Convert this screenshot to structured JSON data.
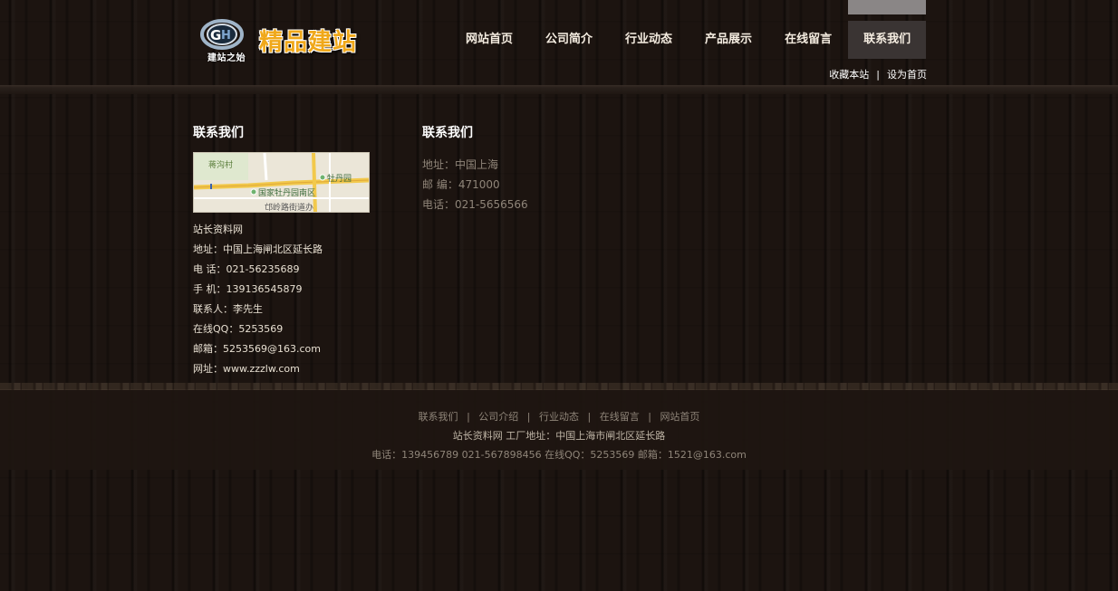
{
  "logo": {
    "small_text": "建站之始",
    "main_text": "精品建站"
  },
  "nav": {
    "items": [
      {
        "label": "网站首页"
      },
      {
        "label": "公司简介"
      },
      {
        "label": "行业动态"
      },
      {
        "label": "产品展示"
      },
      {
        "label": "在线留言"
      },
      {
        "label": "联系我们"
      }
    ],
    "active_index": 5
  },
  "top_links": {
    "bookmark": "收藏本站",
    "separator": "|",
    "set_home": "设为首页"
  },
  "sidebar": {
    "title": "联系我们",
    "map": {
      "labels": [
        "蒋沟村",
        "牡丹园",
        "国家牡丹园南区",
        "邙岭路街道办"
      ]
    },
    "rows": [
      "站长资料网",
      "地址：中国上海闸北区延长路",
      "电 话：021-56235689",
      "手 机：139136545879",
      "联系人：李先生",
      "在线QQ：5253569",
      "邮箱：5253569@163.com",
      "网址：www.zzzlw.com"
    ]
  },
  "content": {
    "title": "联系我们",
    "rows": [
      "地址：中国上海",
      "邮 编：471000",
      "电话：021-5656566"
    ]
  },
  "footer": {
    "links": [
      "联系我们",
      "公司介绍",
      "行业动态",
      "在线留言",
      "网站首页"
    ],
    "separator": "|",
    "address": "站长资料网 工厂地址：中国上海市闸北区延长路",
    "contact": "电话：139456789 021-567898456 在线QQ：5253569 邮箱：1521@163.com"
  },
  "colors": {
    "accent": "#f0a81a",
    "nav_active_bg": "#3a3433",
    "muted_text": "#8f8579"
  }
}
